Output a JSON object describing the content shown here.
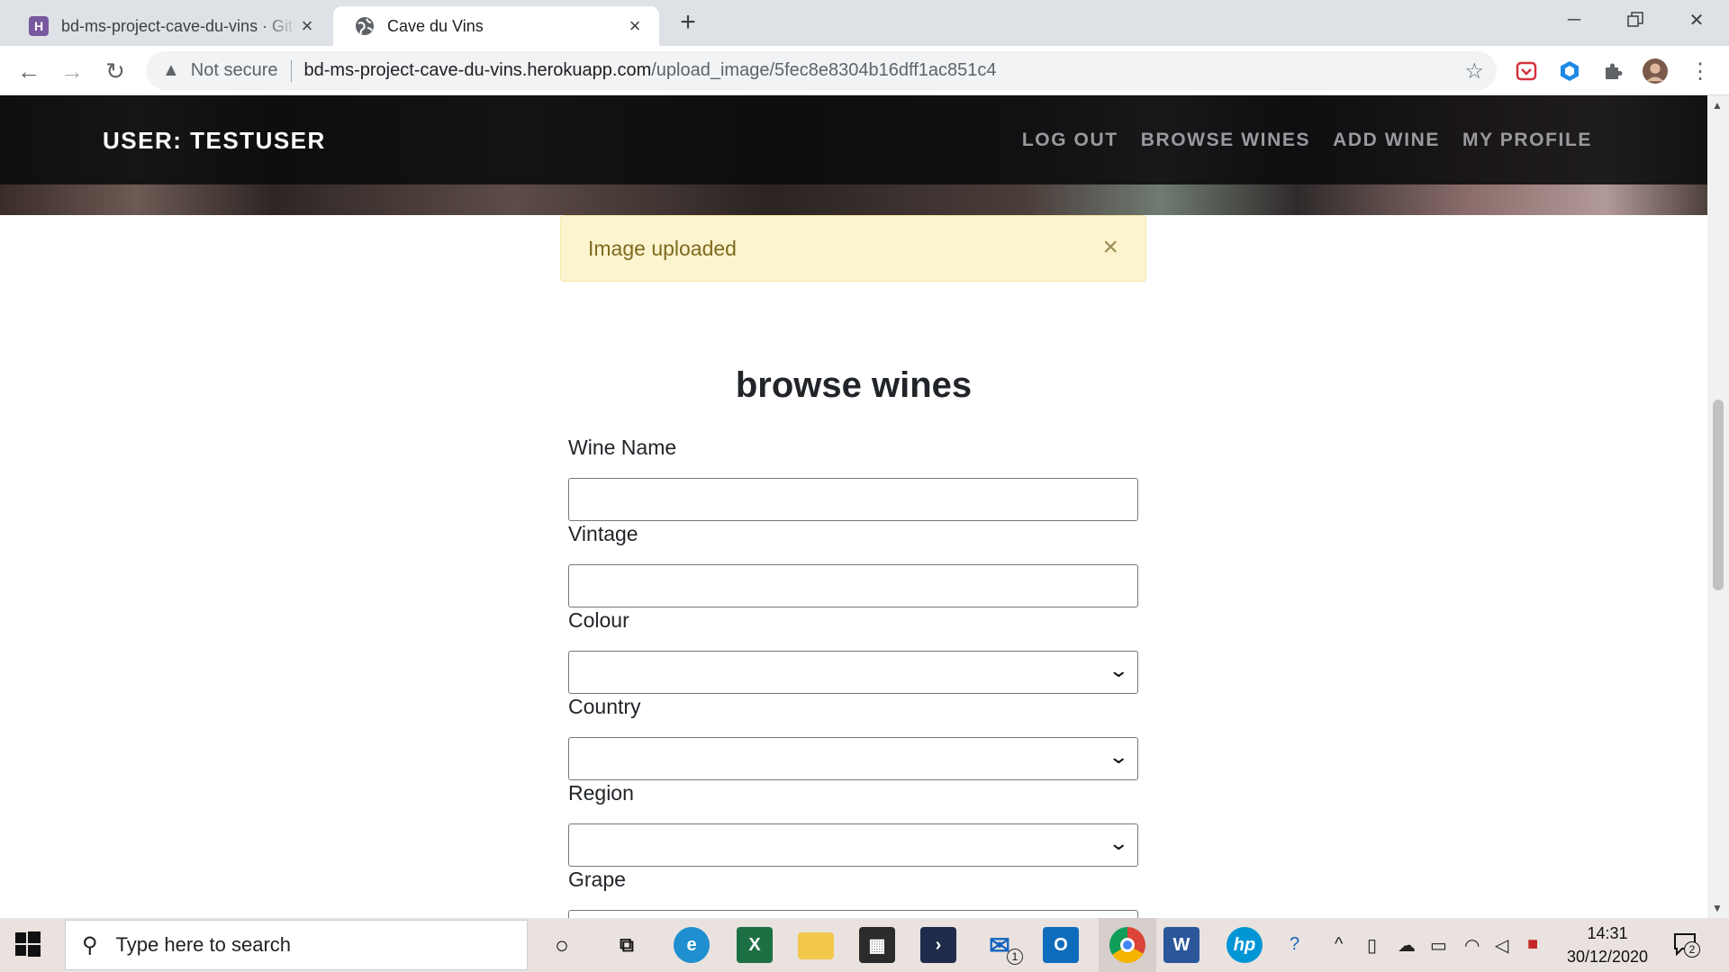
{
  "browser": {
    "tabs": [
      {
        "title": "bd-ms-project-cave-du-vins · Git",
        "favicon": "heroku-icon",
        "active": false
      },
      {
        "title": "Cave du Vins",
        "favicon": "globe-icon",
        "active": true
      }
    ],
    "security_label": "Not secure",
    "url_host": "bd-ms-project-cave-du-vins.herokuapp.com",
    "url_path": "/upload_image/5fec8e8304b16dff1ac851c4"
  },
  "site": {
    "brand": "USER: TESTUSER",
    "nav": [
      "LOG OUT",
      "BROWSE WINES",
      "ADD WINE",
      "MY PROFILE"
    ]
  },
  "flash": {
    "message": "Image uploaded",
    "close": "×"
  },
  "form": {
    "heading": "browse wines",
    "fields": [
      {
        "label": "Wine Name",
        "type": "text",
        "value": ""
      },
      {
        "label": "Vintage",
        "type": "text",
        "value": ""
      },
      {
        "label": "Colour",
        "type": "select",
        "value": ""
      },
      {
        "label": "Country",
        "type": "select",
        "value": ""
      },
      {
        "label": "Region",
        "type": "select",
        "value": ""
      },
      {
        "label": "Grape",
        "type": "select",
        "value": ""
      }
    ]
  },
  "taskbar": {
    "search_placeholder": "Type here to search",
    "time": "14:31",
    "date": "30/12/2020",
    "mail_badge": "1",
    "notification_count": "2"
  },
  "colors": {
    "navbar_bg": "#0a0a0c",
    "nav_link": "#9a9a9e",
    "flash_bg": "#fcf3cf",
    "flash_text": "#7d6b1d",
    "taskbar_bg": "#e9e2df"
  }
}
